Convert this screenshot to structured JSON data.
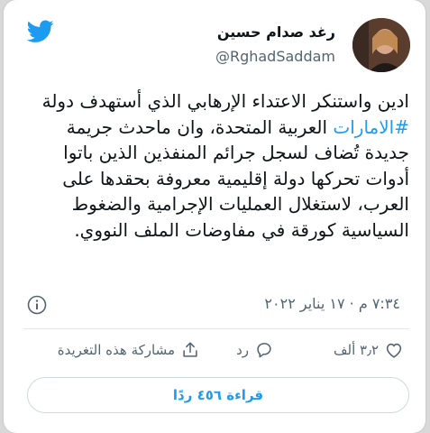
{
  "author": {
    "display_name": "رغد صدام حسين",
    "handle": "@RghadSaddam"
  },
  "brand": {
    "accent": "#1d9bf0"
  },
  "tweet": {
    "text_before": "ادين واستنكر الاعتداء الإرهابي الذي أستهدف دولة ",
    "hashtag": "#الامارات",
    "text_after": " العربية المتحدة، وان ماحدث جريمة جديدة تُضاف لسجل جرائم المنفذين الذين باتوا أدوات تحركها دولة إقليمية معروفة بحقدها على العرب، لاستغلال العمليات الإجرامية والضغوط السياسية كورقة في مفاوضات الملف النووي."
  },
  "meta": {
    "timestamp": "٧:٣٤ م · ١٧ يناير ٢٠٢٢"
  },
  "actions": {
    "likes": "٣٫٢ ألف",
    "reply": "رد",
    "share": "مشاركة هذه التغريدة"
  },
  "replies_button": "قراءة ٤٥٦ ردًا",
  "icons": [
    "twitter-bird-icon",
    "info-icon",
    "heart-icon",
    "reply-icon",
    "share-icon"
  ]
}
